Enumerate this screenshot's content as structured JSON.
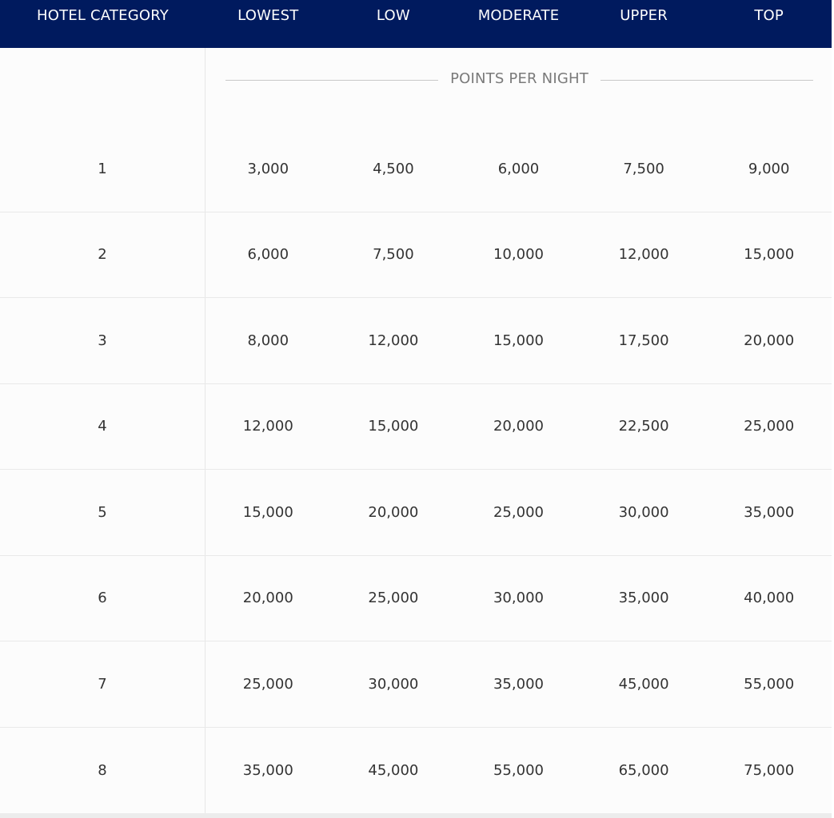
{
  "colors": {
    "header_bg": "#001a5e",
    "header_text": "#ffffff",
    "body_text": "#333333",
    "muted_text": "#7a7a7a"
  },
  "table": {
    "headers": {
      "category": "HOTEL CATEGORY",
      "lowest": "LOWEST",
      "low": "LOW",
      "moderate": "MODERATE",
      "upper": "UPPER",
      "top": "TOP"
    },
    "subheader": "POINTS PER NIGHT",
    "rows": [
      {
        "category": "1",
        "lowest": "3,000",
        "low": "4,500",
        "moderate": "6,000",
        "upper": "7,500",
        "top": "9,000"
      },
      {
        "category": "2",
        "lowest": "6,000",
        "low": "7,500",
        "moderate": "10,000",
        "upper": "12,000",
        "top": "15,000"
      },
      {
        "category": "3",
        "lowest": "8,000",
        "low": "12,000",
        "moderate": "15,000",
        "upper": "17,500",
        "top": "20,000"
      },
      {
        "category": "4",
        "lowest": "12,000",
        "low": "15,000",
        "moderate": "20,000",
        "upper": "22,500",
        "top": "25,000"
      },
      {
        "category": "5",
        "lowest": "15,000",
        "low": "20,000",
        "moderate": "25,000",
        "upper": "30,000",
        "top": "35,000"
      },
      {
        "category": "6",
        "lowest": "20,000",
        "low": "25,000",
        "moderate": "30,000",
        "upper": "35,000",
        "top": "40,000"
      },
      {
        "category": "7",
        "lowest": "25,000",
        "low": "30,000",
        "moderate": "35,000",
        "upper": "45,000",
        "top": "55,000"
      },
      {
        "category": "8",
        "lowest": "35,000",
        "low": "45,000",
        "moderate": "55,000",
        "upper": "65,000",
        "top": "75,000"
      }
    ]
  }
}
